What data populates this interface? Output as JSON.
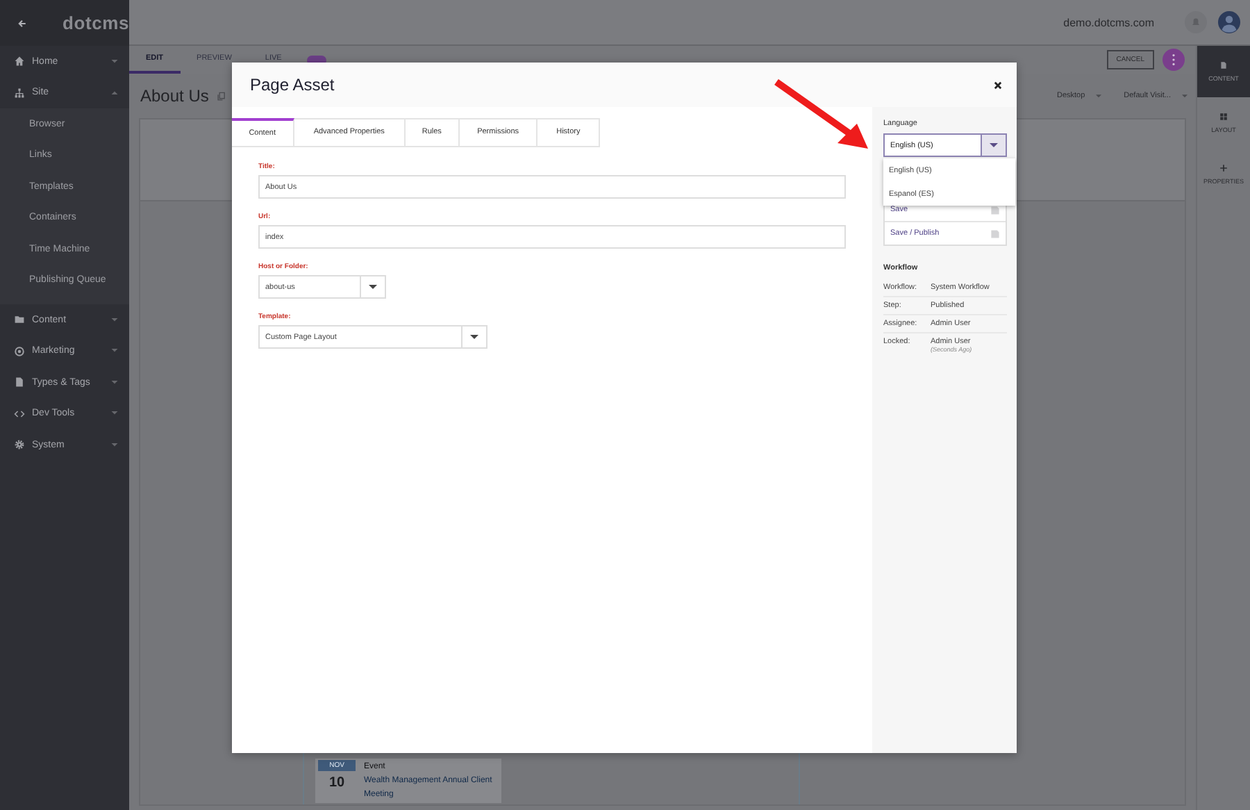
{
  "sidebar": {
    "logo": "dotcms",
    "items": [
      {
        "label": "Home",
        "expanded": false
      },
      {
        "label": "Site",
        "expanded": true,
        "children": [
          {
            "label": "Browser"
          },
          {
            "label": "Links"
          },
          {
            "label": "Templates"
          },
          {
            "label": "Containers"
          },
          {
            "label": "Time Machine"
          },
          {
            "label": "Publishing Queue"
          }
        ]
      },
      {
        "label": "Content",
        "expanded": false
      },
      {
        "label": "Marketing",
        "expanded": false
      },
      {
        "label": "Types & Tags",
        "expanded": false
      },
      {
        "label": "Dev Tools",
        "expanded": false
      },
      {
        "label": "System",
        "expanded": false
      }
    ]
  },
  "top_bar": {
    "host": "demo.dotcms.com"
  },
  "toolbar": {
    "tabs": [
      {
        "label": "EDIT",
        "selected": true
      },
      {
        "label": "PREVIEW",
        "selected": false
      },
      {
        "label": "LIVE",
        "selected": false
      }
    ],
    "lock_toggle": {
      "on": true
    },
    "cancel_button": "CANCEL"
  },
  "right_rail": [
    {
      "label": "CONTENT",
      "selected": true
    },
    {
      "label": "LAYOUT",
      "selected": false
    },
    {
      "label": "PROPERTIES",
      "selected": false
    }
  ],
  "page": {
    "title": "About Us",
    "selectors": [
      "Desktop",
      "Default Visit..."
    ],
    "event": {
      "month": "NOV",
      "day": "10",
      "type": "Event",
      "title": "Wealth Management Annual Client Meeting"
    }
  },
  "modal": {
    "title": "Page Asset",
    "tabs": [
      {
        "label": "Content",
        "selected": true
      },
      {
        "label": "Advanced Properties",
        "selected": false
      },
      {
        "label": "Rules",
        "selected": false
      },
      {
        "label": "Permissions",
        "selected": false
      },
      {
        "label": "History",
        "selected": false
      }
    ],
    "fields": [
      {
        "kind": "text",
        "label": "Title:",
        "value": "About Us"
      },
      {
        "kind": "text",
        "label": "Url:",
        "value": "index"
      },
      {
        "kind": "select",
        "label": "Host or Folder:",
        "value": "about-us"
      },
      {
        "kind": "select",
        "label": "Template:",
        "value": "Custom Page Layout"
      }
    ],
    "language": {
      "label": "Language",
      "value": "English (US)",
      "expanded": true,
      "options": [
        {
          "label": "English (US)"
        },
        {
          "label": "Espanol (ES)"
        }
      ]
    },
    "actions": [
      {
        "label": "Save"
      },
      {
        "label": "Save / Publish"
      }
    ],
    "workflow": {
      "title": "Workflow",
      "rows": [
        {
          "label": "Workflow:",
          "value": "System Workflow"
        },
        {
          "label": "Step:",
          "value": "Published"
        },
        {
          "label": "Assignee:",
          "value": "Admin User"
        },
        {
          "label": "Locked:",
          "value": "Admin User",
          "note": "(Seconds Ago)"
        }
      ]
    }
  }
}
